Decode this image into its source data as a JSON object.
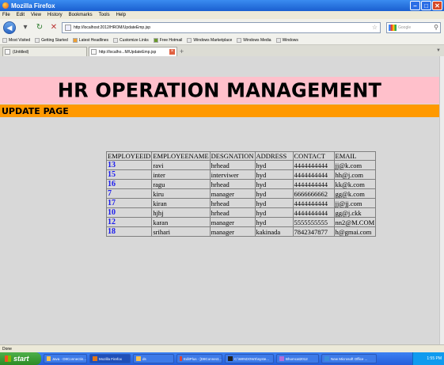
{
  "window": {
    "title": "Mozilla Firefox"
  },
  "menu": [
    "File",
    "Edit",
    "View",
    "History",
    "Bookmarks",
    "Tools",
    "Help"
  ],
  "url": "http://localhost:2012/HROM/UpdateEmp.jsp",
  "search_placeholder": "Google",
  "bookmarks": [
    "Most Visited",
    "Getting Started",
    "Latest Headlines",
    "Customize Links",
    "Free Hotmail",
    "Windows Marketplace",
    "Windows Media",
    "Windows"
  ],
  "tabs": [
    {
      "label": "(Untitled)"
    },
    {
      "label": "http://localho...M/UpdateEmp.jsp"
    }
  ],
  "page": {
    "title": "HR OPERATION MANAGEMENT",
    "subtitle": "UPDATE PAGE"
  },
  "table": {
    "headers": [
      "EMPLOYEEID",
      "EMPLOYEENAME",
      "DESGNATION",
      "ADDRESS",
      "CONTACT",
      "EMAIL"
    ],
    "rows": [
      [
        "13",
        "ravi",
        "hrhead",
        "hyd",
        "4444444444",
        "jj@k.com"
      ],
      [
        "15",
        "inter",
        "interviwer",
        "hyd",
        "4444444444",
        "hh@j.com"
      ],
      [
        "16",
        "ragu",
        "hrhead",
        "hyd",
        "4444444444",
        "kk@k.com"
      ],
      [
        "7",
        "kiru",
        "manager",
        "hyd",
        "6666666662",
        "gg@k.com"
      ],
      [
        "17",
        "kiran",
        "hrhead",
        "hyd",
        "4444444444",
        "jj@jj.com"
      ],
      [
        "10",
        "hjhj",
        "hrhead",
        "hyd",
        "4444444444",
        "gg@j.ckk"
      ],
      [
        "12",
        "karan",
        "manager",
        "hyd",
        "5555555555",
        "nn2@M.COM"
      ],
      [
        "18",
        "srihari",
        "manager",
        "kakinada",
        "7842347877",
        "h@gmai.com"
      ]
    ]
  },
  "status": "Done",
  "taskbar": {
    "start": "start",
    "items": [
      "Java - D8Connectin...",
      "Mozilla Firefox",
      "ds",
      "EditPlus - [D8Connect...",
      "C:\\WINDOWS\\syste...",
      "Bhomcat2012",
      "New Microsoft Office ..."
    ],
    "clock": "1:55 PM"
  }
}
